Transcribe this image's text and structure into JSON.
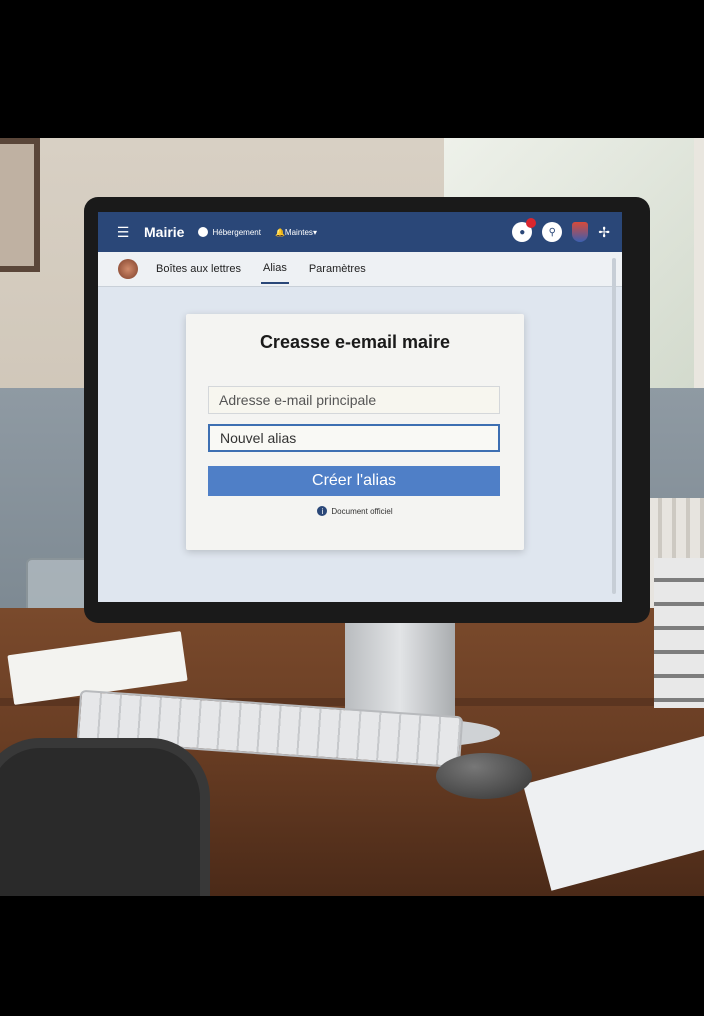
{
  "app": {
    "brand": "Mairie",
    "nav": [
      {
        "label": "Hébergement"
      },
      {
        "label": "Maintes"
      }
    ],
    "icons": {
      "notifications": "notification-icon",
      "search": "search-icon",
      "profile": "shield-icon",
      "settings": "pin-icon"
    }
  },
  "tabs": [
    {
      "label": "Boîtes aux lettres"
    },
    {
      "label": "Alias"
    },
    {
      "label": "Paramètres"
    }
  ],
  "form": {
    "title": "Creasse e-email maire",
    "primary_placeholder": "Adresse e-mail principale",
    "alias_placeholder": "Nouvel alias",
    "submit_label": "Créer l'alias",
    "footer_text": "Document officiel"
  },
  "colors": {
    "accent": "#2a4778",
    "button": "#4f7fc7"
  }
}
